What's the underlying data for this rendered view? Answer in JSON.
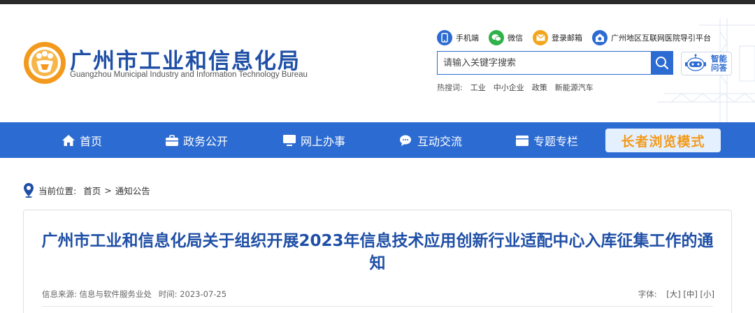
{
  "header": {
    "title": "广州市工业和信息化局",
    "subtitle": "Guangzhou Municipal Industry and Information Technology Bureau",
    "quick_links": [
      {
        "label": "手机端",
        "icon": "mobile-icon",
        "color": "#2c6bd1"
      },
      {
        "label": "微信",
        "icon": "wechat-icon",
        "color": "#2fb24a"
      },
      {
        "label": "登录邮箱",
        "icon": "mail-icon",
        "color": "#f3a51b"
      },
      {
        "label": "广州地区互联网医院导引平台",
        "icon": "hospital-icon",
        "color": "#2c6bd1"
      }
    ],
    "search": {
      "placeholder": "请输入关键字搜索",
      "button_icon": "search-icon"
    },
    "ai": {
      "line1": "智能",
      "line2": "问答"
    },
    "hot": {
      "label": "热搜词:",
      "keywords": [
        "工业",
        "中小企业",
        "政策",
        "新能源汽车"
      ]
    }
  },
  "nav": {
    "items": [
      {
        "label": "首页",
        "icon": "home-icon"
      },
      {
        "label": "政务公开",
        "icon": "briefcase-icon"
      },
      {
        "label": "网上办事",
        "icon": "monitor-icon"
      },
      {
        "label": "互动交流",
        "icon": "chat-icon"
      },
      {
        "label": "专题专栏",
        "icon": "calendar-icon"
      }
    ],
    "elder_mode": "长者浏览模式"
  },
  "breadcrumb": {
    "label": "当前位置:",
    "items": [
      "首页",
      "通知公告"
    ],
    "separator": ">"
  },
  "article": {
    "title": "广州市工业和信息化局关于组织开展2023年信息技术应用创新行业适配中心入库征集工作的通知",
    "source_label": "信息来源:",
    "source": "信息与软件服务业处",
    "time_label": "时间:",
    "time": "2023-07-25",
    "font_label": "字体:",
    "font_sizes": [
      "[大]",
      "[中]",
      "[小]"
    ]
  },
  "colors": {
    "brand_blue": "#2c6bd1",
    "title_blue": "#1f4fa6",
    "elder_orange": "#f29a1a"
  }
}
